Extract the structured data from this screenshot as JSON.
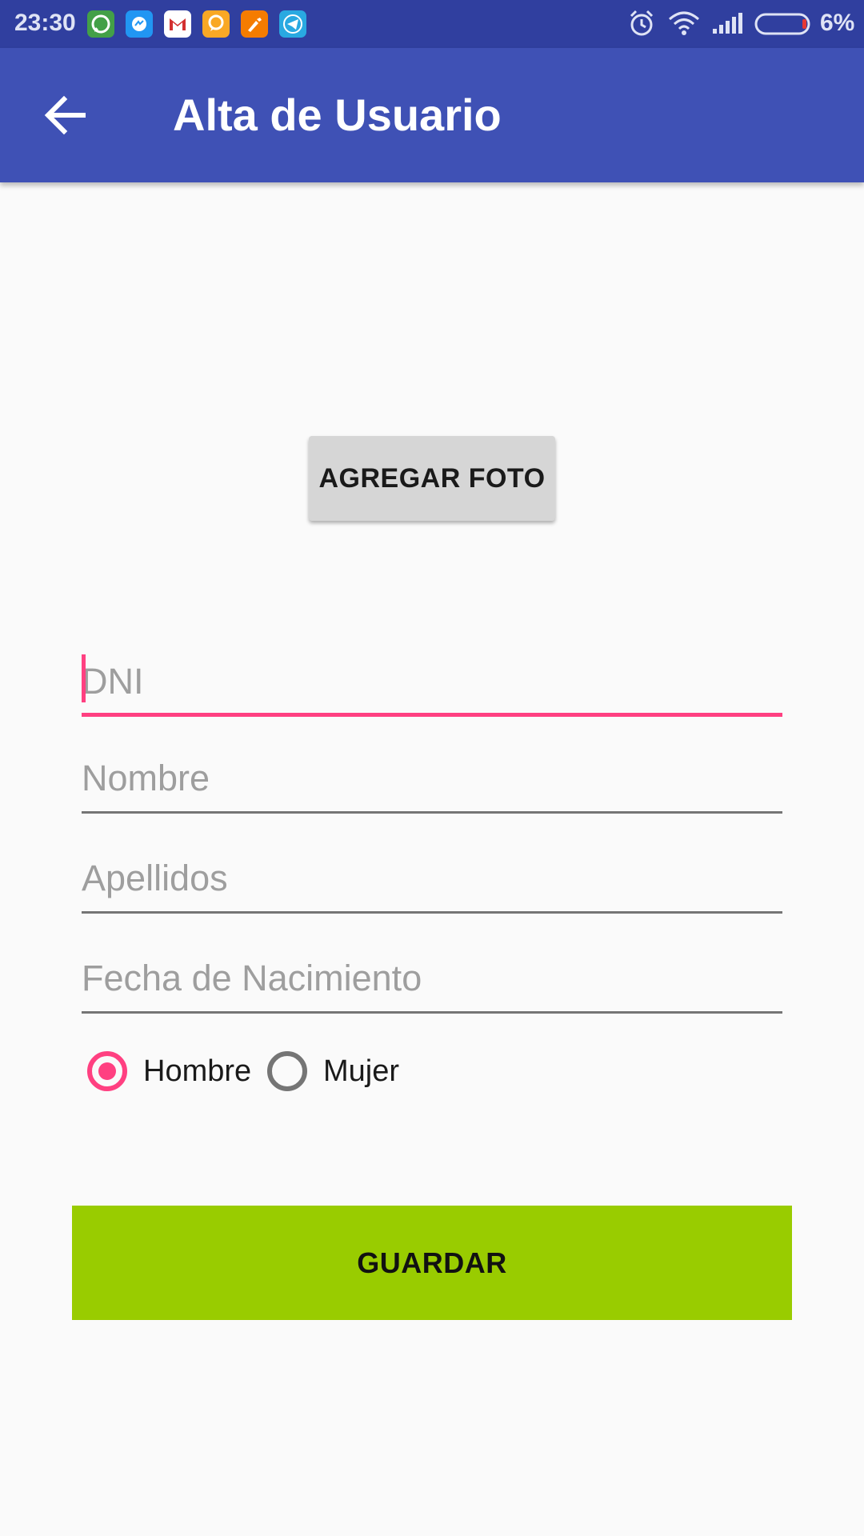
{
  "status_bar": {
    "time": "23:30",
    "notification_icons": [
      "whatsapp-icon",
      "messenger-icon",
      "gmail-icon",
      "chat-icon",
      "brush-app-icon",
      "telegram-icon"
    ],
    "system_icons": [
      "alarm-icon",
      "wifi-icon",
      "signal-icon",
      "battery-icon"
    ],
    "battery": "6%"
  },
  "app_bar": {
    "title": "Alta de Usuario",
    "back_icon": "arrow-back-icon",
    "background": "#3f51b5"
  },
  "form": {
    "add_photo_label": "AGREGAR FOTO",
    "fields": [
      {
        "placeholder": "DNI",
        "value": "",
        "focused": true
      },
      {
        "placeholder": "Nombre",
        "value": ""
      },
      {
        "placeholder": "Apellidos",
        "value": ""
      },
      {
        "placeholder": "Fecha de Nacimiento",
        "value": ""
      }
    ],
    "gender_options": [
      {
        "label": "Hombre",
        "checked": true
      },
      {
        "label": "Mujer",
        "checked": false
      }
    ],
    "save_label": "GUARDAR"
  },
  "colors": {
    "primary": "#3f51b5",
    "primary_dark": "#303f9f",
    "accent": "#ff4081",
    "save_button": "#99cc00"
  }
}
